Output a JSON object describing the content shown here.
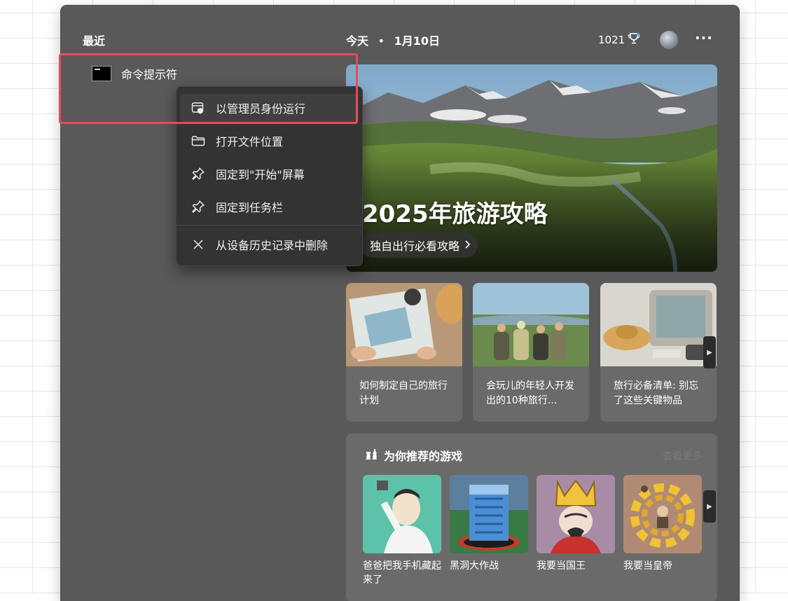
{
  "start_menu": {
    "recent": {
      "title": "最近",
      "items": [
        {
          "label": "命令提示符",
          "icon": "command-prompt-icon"
        }
      ]
    },
    "context_menu": {
      "items": [
        {
          "label": "以管理员身份运行",
          "icon": "shield-window-icon",
          "highlighted": true
        },
        {
          "label": "打开文件位置",
          "icon": "folder-icon"
        },
        {
          "label": "固定到\"开始\"屏幕",
          "icon": "pin-icon"
        },
        {
          "label": "固定到任务栏",
          "icon": "pin-icon"
        },
        {
          "label": "从设备历史记录中删除",
          "icon": "close-icon"
        }
      ]
    }
  },
  "header": {
    "today": "今天",
    "separator": "•",
    "date": "1月10日",
    "points": "1021",
    "points_icon": "trophy-icon",
    "avatar_icon": "avatar",
    "more": "···"
  },
  "hero": {
    "title": "2025年旅游攻略",
    "button_label": "独自出行必看攻略",
    "button_icon": "chevron-right-icon"
  },
  "cards": [
    {
      "text": "如何制定自己的旅行计划"
    },
    {
      "text": "会玩儿的年轻人开发出的10种旅行..."
    },
    {
      "text": "旅行必备清单: 别忘了这些关键物品"
    }
  ],
  "games": {
    "title": "为你推荐的游戏",
    "see_more": "查看更多",
    "items": [
      {
        "label": "爸爸把我手机藏起来了"
      },
      {
        "label": "黑洞大作战"
      },
      {
        "label": "我要当国王"
      },
      {
        "label": "我要当皇帝"
      }
    ]
  },
  "colors": {
    "panel_bg": "#595959",
    "menu_bg": "#333333",
    "card_bg": "#6a6a6a",
    "highlight_border": "#e8495a"
  }
}
